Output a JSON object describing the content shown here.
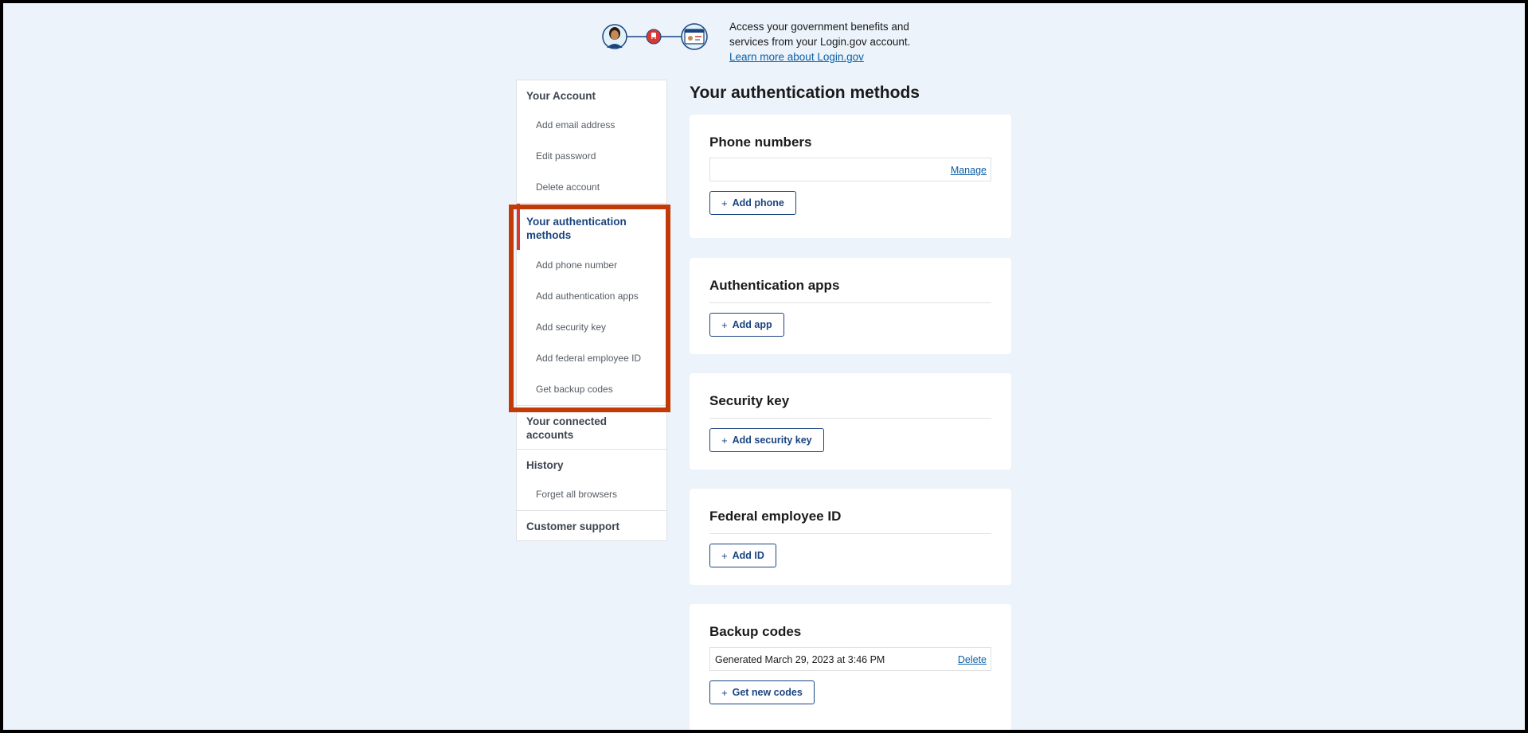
{
  "banner": {
    "line1": "Access your government benefits and",
    "line2": "services from your Login.gov account.",
    "link": "Learn more about Login.gov"
  },
  "sidebar": {
    "groups": [
      {
        "heading": "Your Account",
        "items": [
          "Add email address",
          "Edit password",
          "Delete account"
        ]
      },
      {
        "heading": "Your authentication methods",
        "items": [
          "Add phone number",
          "Add authentication apps",
          "Add security key",
          "Add federal employee ID",
          "Get backup codes"
        ]
      },
      {
        "heading": "Your connected accounts",
        "items": []
      },
      {
        "heading": "History",
        "items": [
          "Forget all browsers"
        ]
      },
      {
        "heading": "Customer support",
        "items": []
      }
    ]
  },
  "main": {
    "title": "Your authentication methods",
    "phone": {
      "heading": "Phone numbers",
      "manage": "Manage",
      "button": "Add phone"
    },
    "apps": {
      "heading": "Authentication apps",
      "button": "Add app"
    },
    "security_key": {
      "heading": "Security key",
      "button": "Add security key"
    },
    "piv": {
      "heading": "Federal employee ID",
      "button": "Add ID"
    },
    "backup": {
      "heading": "Backup codes",
      "generated": "Generated March 29, 2023 at 3:46 PM",
      "delete": "Delete",
      "button": "Get new codes"
    }
  },
  "colors": {
    "accent": "#1a4480",
    "link": "#0b5ea6",
    "active_bar": "#d83933",
    "highlight": "#c23a05",
    "background": "#ecf3fa"
  }
}
